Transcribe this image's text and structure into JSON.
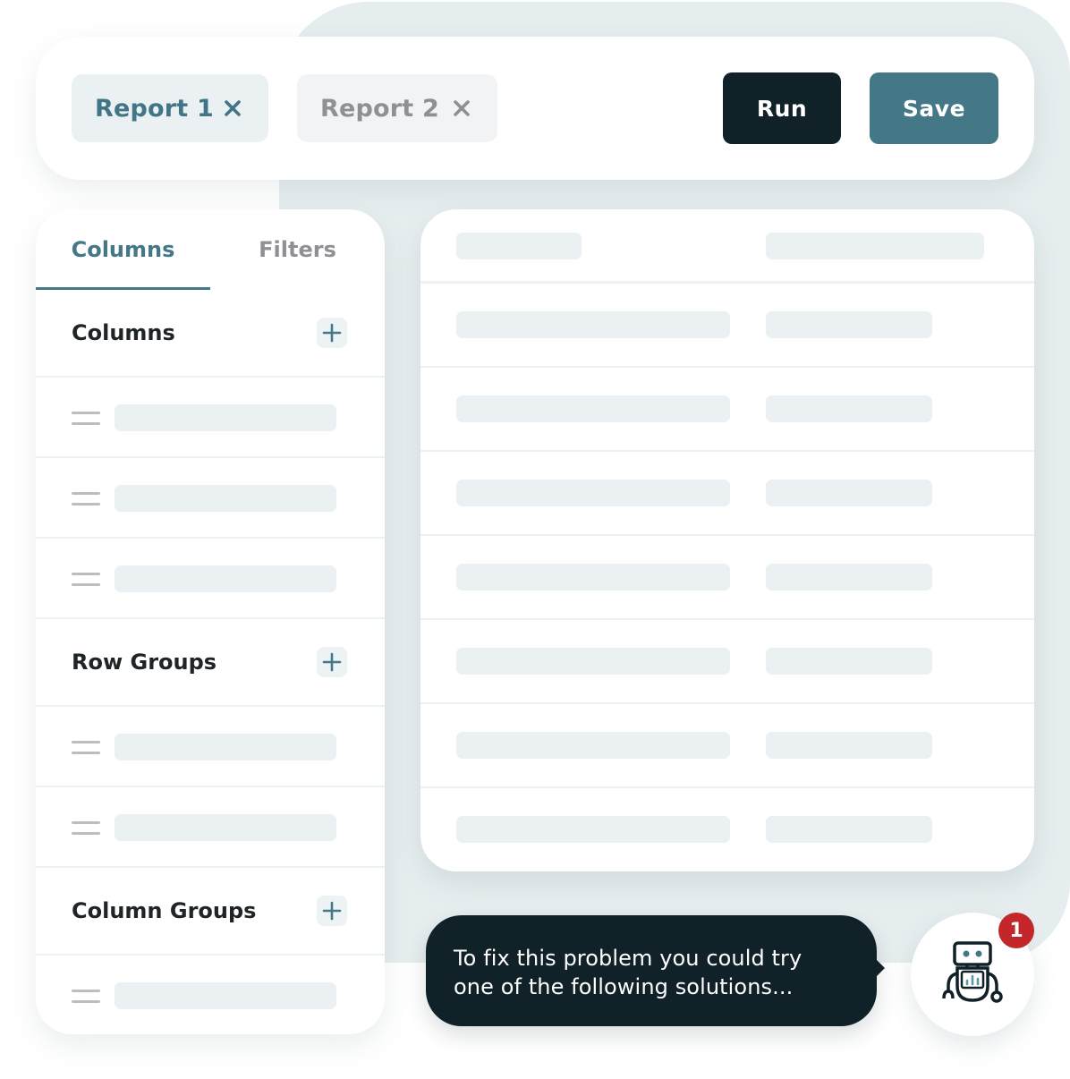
{
  "toolbar": {
    "tabs": [
      {
        "label": "Report 1",
        "active": true,
        "close_icon": "close-icon"
      },
      {
        "label": "Report 2",
        "active": false,
        "close_icon": "close-icon"
      }
    ],
    "run_label": "Run",
    "save_label": "Save"
  },
  "side_panel": {
    "tabs": [
      {
        "label": "Columns",
        "active": true
      },
      {
        "label": "Filters",
        "active": false
      }
    ],
    "sections": [
      {
        "title": "Columns",
        "add_icon": "plus-icon",
        "item_count": 3
      },
      {
        "title": "Row Groups",
        "add_icon": "plus-icon",
        "item_count": 2
      },
      {
        "title": "Column Groups",
        "add_icon": "plus-icon",
        "item_count": 1
      }
    ]
  },
  "grid": {
    "row_count": 8,
    "placeholder": "skeleton"
  },
  "assistant": {
    "message_line1": "To fix this problem you could try",
    "message_line2": "one of the following solutions...",
    "avatar_icon": "robot-icon",
    "badge_count": "1"
  },
  "colors": {
    "accent": "#447887",
    "dark": "#102128",
    "badge": "#c3272b",
    "skeleton": "#ebf0f2",
    "background": "#e6edef"
  }
}
